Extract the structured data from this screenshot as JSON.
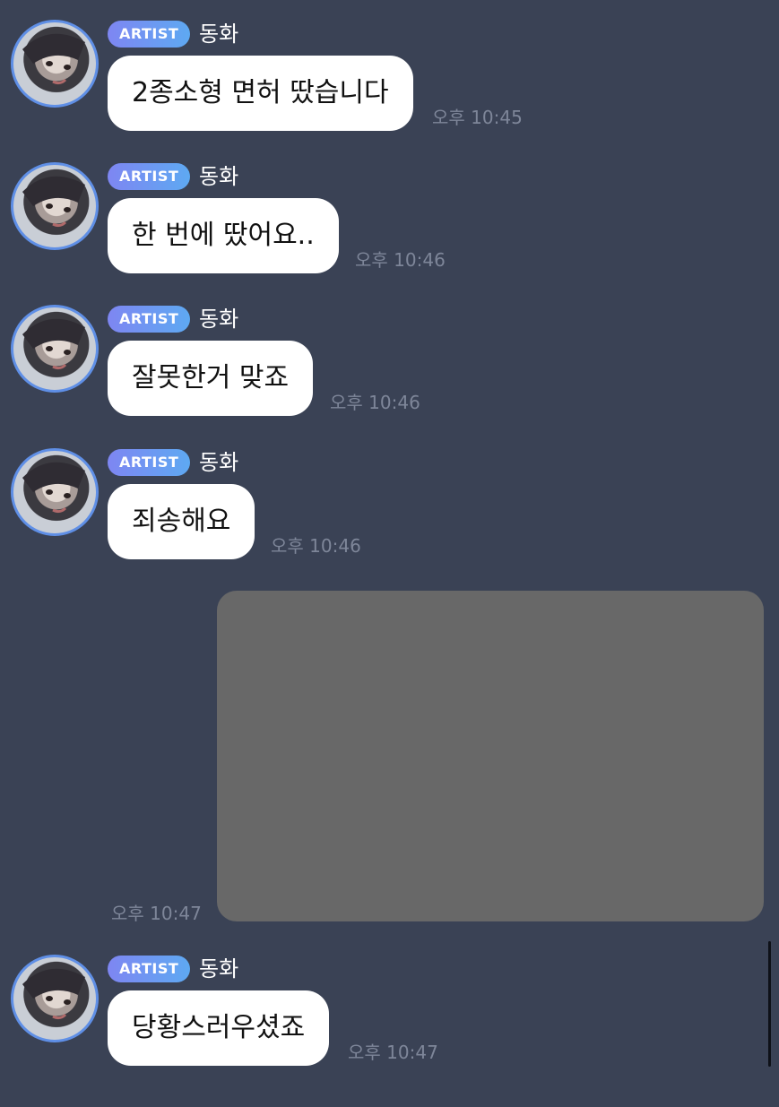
{
  "chat": {
    "messages": [
      {
        "badge": "ARTIST",
        "sender": "동화",
        "text": "2종소형 면허 땄습니다",
        "time": "오후 10:45"
      },
      {
        "badge": "ARTIST",
        "sender": "동화",
        "text": "한 번에 땄어요..",
        "time": "오후 10:46"
      },
      {
        "badge": "ARTIST",
        "sender": "동화",
        "text": "잘못한거 맞죠",
        "time": "오후 10:46"
      },
      {
        "badge": "ARTIST",
        "sender": "동화",
        "text": "죄송해요",
        "time": "오후 10:46"
      },
      {
        "badge": "ARTIST",
        "sender": "동화",
        "text": "당황스러우셨죠",
        "time": "오후 10:47"
      }
    ],
    "photo_message": {
      "time": "오후 10:47"
    }
  },
  "colors": {
    "background": "#3a4255",
    "bubble": "#ffffff",
    "badge_gradient_start": "#7e86f2",
    "badge_gradient_end": "#5ea9f2",
    "avatar_ring": "#5f8fe6",
    "timestamp": "#7e8699",
    "image_placeholder": "#686868"
  },
  "icons": {
    "avatar": "artist-profile-photo"
  }
}
